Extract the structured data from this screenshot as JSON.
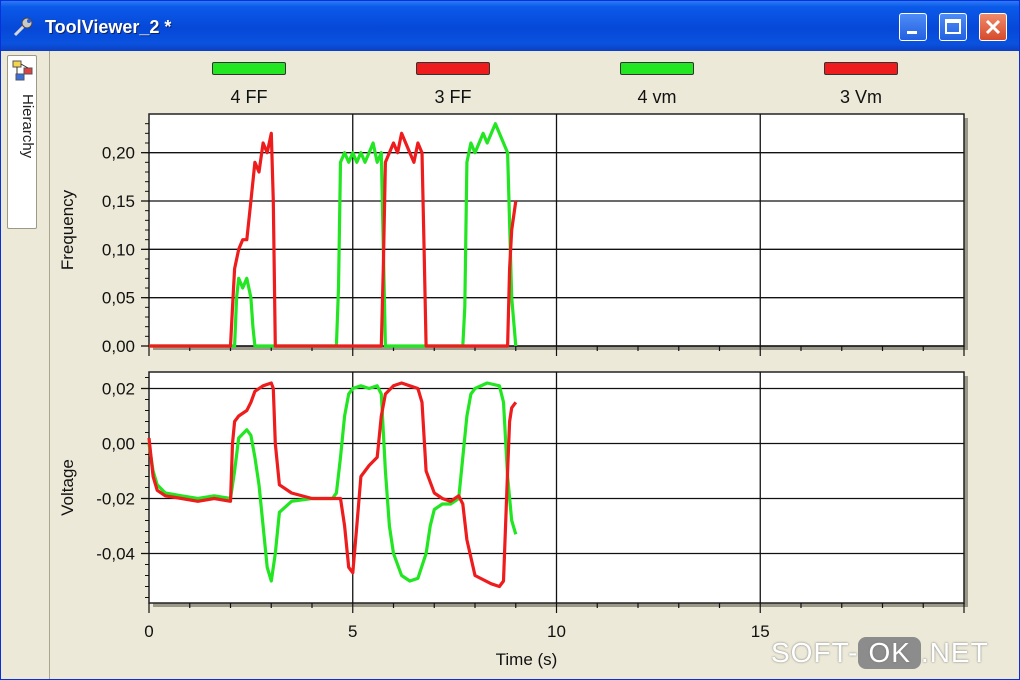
{
  "window": {
    "title": "ToolViewer_2 *",
    "controls": [
      "minimize-icon",
      "maximize-icon",
      "close-icon"
    ]
  },
  "sidebar": {
    "tab_label": "Hierarchy",
    "icon": "hierarchy-icon"
  },
  "legend": [
    {
      "label": "4 FF",
      "color": "#22e622"
    },
    {
      "label": "3 FF",
      "color": "#ee1c1c"
    },
    {
      "label": "4 vm",
      "color": "#22e622"
    },
    {
      "label": "3 Vm",
      "color": "#ee1c1c"
    }
  ],
  "watermark": {
    "left": "SOFT-",
    "box": "OK",
    "right": ".NET"
  },
  "chart_data": [
    {
      "type": "line",
      "ylabel": "Frequency",
      "xlim": [
        0,
        20
      ],
      "ylim": [
        0,
        0.24
      ],
      "yticks": [
        "0,00",
        "0,05",
        "0,10",
        "0,15",
        "0,20"
      ],
      "grid": true,
      "series": [
        {
          "name": "4 FF",
          "color": "#22e622",
          "x": [
            0,
            2.1,
            2.15,
            2.2,
            2.3,
            2.4,
            2.5,
            2.55,
            2.6,
            4.6,
            4.65,
            4.7,
            4.8,
            4.9,
            5.0,
            5.1,
            5.2,
            5.3,
            5.4,
            5.5,
            5.6,
            5.7,
            5.8,
            7.7,
            7.75,
            7.8,
            7.9,
            8.0,
            8.1,
            8.2,
            8.3,
            8.4,
            8.5,
            8.6,
            8.7,
            8.8,
            8.9,
            9.0
          ],
          "y": [
            0,
            0,
            0.05,
            0.07,
            0.06,
            0.07,
            0.05,
            0.02,
            0,
            0,
            0.06,
            0.19,
            0.2,
            0.19,
            0.2,
            0.19,
            0.2,
            0.19,
            0.2,
            0.21,
            0.19,
            0.2,
            0,
            0,
            0.04,
            0.19,
            0.21,
            0.2,
            0.21,
            0.22,
            0.21,
            0.22,
            0.23,
            0.22,
            0.21,
            0.2,
            0.05,
            0
          ]
        },
        {
          "name": "3 FF",
          "color": "#ee1c1c",
          "x": [
            0,
            2.0,
            2.05,
            2.1,
            2.2,
            2.3,
            2.4,
            2.5,
            2.6,
            2.7,
            2.8,
            2.9,
            3.0,
            3.05,
            3.1,
            5.7,
            5.75,
            5.8,
            5.9,
            6.0,
            6.1,
            6.2,
            6.3,
            6.4,
            6.5,
            6.6,
            6.7,
            6.75,
            6.8,
            8.8,
            8.85,
            8.9,
            9.0
          ],
          "y": [
            0,
            0,
            0.04,
            0.08,
            0.1,
            0.11,
            0.11,
            0.15,
            0.19,
            0.18,
            0.21,
            0.2,
            0.22,
            0.15,
            0,
            0,
            0.08,
            0.19,
            0.2,
            0.21,
            0.2,
            0.22,
            0.21,
            0.2,
            0.19,
            0.21,
            0.2,
            0.1,
            0,
            0,
            0.08,
            0.12,
            0.15
          ]
        }
      ]
    },
    {
      "type": "line",
      "xlabel": "Time (s)",
      "ylabel": "Voltage",
      "xlim": [
        0,
        20
      ],
      "ylim": [
        -0.058,
        0.026
      ],
      "xticks": [
        "0",
        "5",
        "10",
        "15"
      ],
      "yticks": [
        "0,02",
        "0,00",
        "-0,02",
        "-0,04"
      ],
      "grid": true,
      "series": [
        {
          "name": "4 vm",
          "color": "#22e622",
          "x": [
            0,
            0.1,
            0.2,
            0.4,
            0.8,
            1.2,
            1.6,
            2.0,
            2.1,
            2.2,
            2.4,
            2.5,
            2.6,
            2.7,
            2.8,
            2.9,
            3.0,
            3.1,
            3.2,
            3.5,
            4.0,
            4.5,
            4.6,
            4.7,
            4.8,
            4.9,
            5.0,
            5.2,
            5.4,
            5.6,
            5.7,
            5.8,
            5.9,
            6.0,
            6.2,
            6.4,
            6.6,
            6.8,
            6.9,
            7.0,
            7.2,
            7.4,
            7.6,
            7.7,
            7.8,
            7.9,
            8.0,
            8.3,
            8.6,
            8.7,
            8.8,
            8.9,
            9.0
          ],
          "y": [
            0,
            -0.01,
            -0.015,
            -0.018,
            -0.019,
            -0.02,
            -0.019,
            -0.02,
            -0.01,
            0.002,
            0.005,
            0.003,
            -0.005,
            -0.015,
            -0.03,
            -0.045,
            -0.05,
            -0.04,
            -0.025,
            -0.021,
            -0.02,
            -0.02,
            -0.018,
            -0.005,
            0.01,
            0.018,
            0.02,
            0.021,
            0.02,
            0.021,
            0.018,
            -0.01,
            -0.03,
            -0.04,
            -0.048,
            -0.05,
            -0.049,
            -0.04,
            -0.03,
            -0.024,
            -0.022,
            -0.022,
            -0.02,
            -0.005,
            0.01,
            0.018,
            0.02,
            0.022,
            0.021,
            0.015,
            -0.012,
            -0.028,
            -0.033
          ]
        },
        {
          "name": "3 Vm",
          "color": "#ee1c1c",
          "x": [
            0,
            0.1,
            0.2,
            0.4,
            0.8,
            1.2,
            1.6,
            2.0,
            2.05,
            2.1,
            2.2,
            2.4,
            2.5,
            2.6,
            2.8,
            3.0,
            3.05,
            3.1,
            3.2,
            3.5,
            4.0,
            4.5,
            4.7,
            4.8,
            4.9,
            5.0,
            5.1,
            5.2,
            5.4,
            5.6,
            5.7,
            5.8,
            6.0,
            6.2,
            6.4,
            6.6,
            6.7,
            6.8,
            7.0,
            7.2,
            7.4,
            7.6,
            7.7,
            7.8,
            8.0,
            8.4,
            8.6,
            8.7,
            8.8,
            8.85,
            8.9,
            9.0
          ],
          "y": [
            0.002,
            -0.012,
            -0.017,
            -0.019,
            -0.02,
            -0.021,
            -0.02,
            -0.021,
            0.0,
            0.008,
            0.01,
            0.012,
            0.015,
            0.019,
            0.021,
            0.022,
            0.02,
            0.0,
            -0.015,
            -0.018,
            -0.02,
            -0.02,
            -0.02,
            -0.03,
            -0.045,
            -0.047,
            -0.03,
            -0.012,
            -0.008,
            -0.005,
            0.01,
            0.018,
            0.021,
            0.022,
            0.021,
            0.02,
            0.015,
            -0.01,
            -0.018,
            -0.02,
            -0.021,
            -0.019,
            -0.022,
            -0.035,
            -0.048,
            -0.051,
            -0.052,
            -0.05,
            -0.01,
            0.008,
            0.013,
            0.015
          ]
        }
      ]
    }
  ]
}
